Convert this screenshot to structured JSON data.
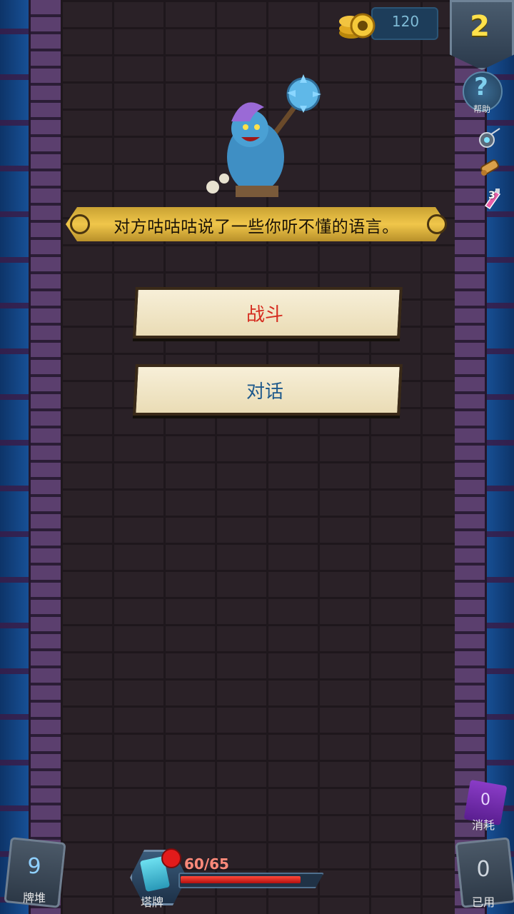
{
  "hud": {
    "gold": "120",
    "floor": "2",
    "help_label": "帮助"
  },
  "relics": {
    "potion_count": "3"
  },
  "event": {
    "message": "对方咕咕咕说了一些你听不懂的语言。",
    "options": [
      {
        "label": "战斗",
        "color": "#d52a1e"
      },
      {
        "label": "对话",
        "color": "#1f5a8c"
      }
    ]
  },
  "bottom": {
    "deck_count": "9",
    "deck_label": "牌堆",
    "tower_label": "塔牌",
    "hp_text": "60/65",
    "hp_fraction": 0.923,
    "consume_count": "0",
    "consume_label": "消耗",
    "used_count": "0",
    "used_label": "已用"
  },
  "colors": {
    "banner": "#f0c64a",
    "floor_number": "#ffe14a",
    "hp": "#ff4a3a"
  }
}
